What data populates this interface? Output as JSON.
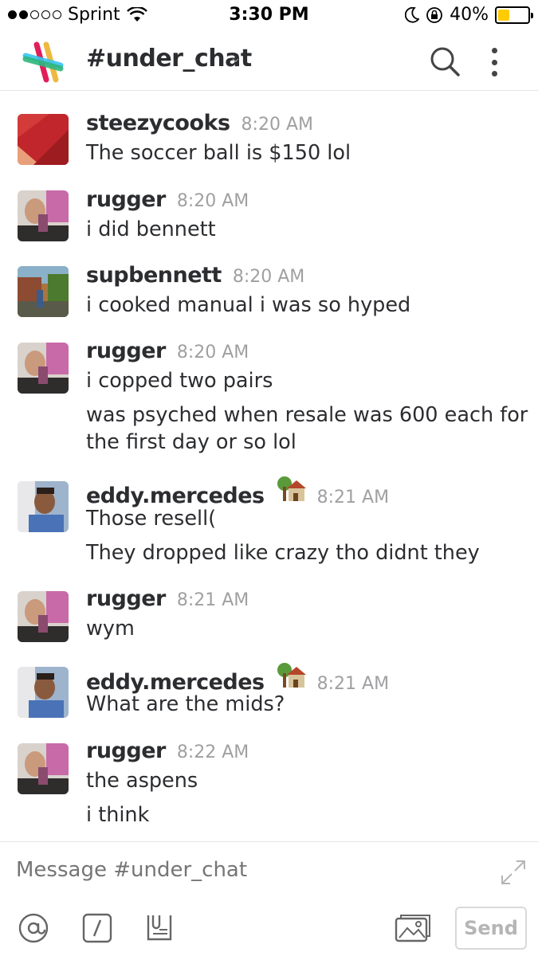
{
  "status_bar": {
    "carrier": "Sprint",
    "time": "3:30 PM",
    "battery_percent": "40%",
    "battery_level": 0.4,
    "signal_bars_filled": 2,
    "signal_bars_total": 5
  },
  "header": {
    "channel": "#under_chat",
    "caret": "⌄"
  },
  "messages": [
    {
      "user": "steezycooks",
      "time": "8:20 AM",
      "lines": [
        "The soccer ball is $150 lol"
      ]
    },
    {
      "user": "rugger",
      "time": "8:20 AM",
      "lines": [
        "i did bennett"
      ]
    },
    {
      "user": "supbennett",
      "time": "8:20 AM",
      "lines": [
        "i cooked manual i was so hyped"
      ]
    },
    {
      "user": "rugger",
      "time": "8:20 AM",
      "lines": [
        "i copped two pairs",
        "was psyched when resale was 600 each for",
        "the first day or so lol"
      ]
    },
    {
      "user": "eddy.mercedes",
      "time": "8:21 AM",
      "lines": [
        "Those resell(",
        "They dropped like crazy tho didnt they"
      ]
    },
    {
      "user": "rugger",
      "time": "8:21 AM",
      "lines": [
        "wym"
      ]
    },
    {
      "user": "eddy.mercedes",
      "time": "8:21 AM",
      "lines": [
        "What are the mids?"
      ]
    },
    {
      "user": "rugger",
      "time": "8:22 AM",
      "lines": [
        "the aspens",
        "i think"
      ]
    }
  ],
  "composer": {
    "placeholder": "Message #under_chat",
    "send_label": "Send"
  },
  "colors": {
    "text": "#2c2d30",
    "muted": "#a0a0a2",
    "battery": "#ffcc00"
  },
  "icons": [
    "slack-logo",
    "search-icon",
    "more-vertical-icon",
    "house-emoji",
    "expand-icon",
    "at-mention-icon",
    "slash-command-icon",
    "file-upload-icon",
    "photo-icon"
  ]
}
